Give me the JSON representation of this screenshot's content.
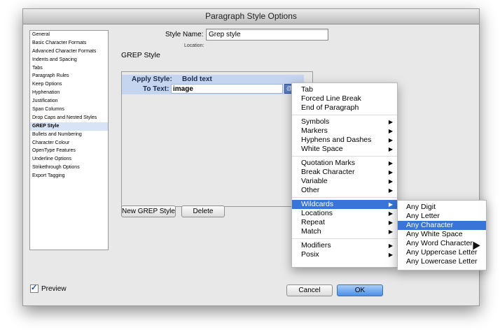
{
  "dialog": {
    "title": "Paragraph Style Options"
  },
  "categories": [
    "General",
    "Basic Character Formats",
    "Advanced Character Formats",
    "Indents and Spacing",
    "Tabs",
    "Paragraph Rules",
    "Keep Options",
    "Hyphenation",
    "Justification",
    "Span Columns",
    "Drop Caps and Nested Styles",
    "GREP Style",
    "Bullets and Numbering",
    "Character Colour",
    "OpenType Features",
    "Underline Options",
    "Strikethrough Options",
    "Export Tagging"
  ],
  "selected_category": "GREP Style",
  "style_name": {
    "label": "Style Name:",
    "value": "Grep style"
  },
  "location": {
    "label": "Location:"
  },
  "section_title": "GREP Style",
  "grep": {
    "apply_label": "Apply Style:",
    "apply_value": "Bold text",
    "to_label": "To Text:",
    "to_value": "image"
  },
  "buttons": {
    "new_grep": "New GREP Style",
    "delete": "Delete",
    "cancel": "Cancel",
    "ok": "OK"
  },
  "preview": {
    "label": "Preview",
    "checked": true
  },
  "menu": [
    {
      "label": "Tab"
    },
    {
      "label": "Forced Line Break"
    },
    {
      "label": "End of Paragraph"
    },
    {
      "sep": true
    },
    {
      "label": "Symbols",
      "sub": true
    },
    {
      "label": "Markers",
      "sub": true
    },
    {
      "label": "Hyphens and Dashes",
      "sub": true
    },
    {
      "label": "White Space",
      "sub": true
    },
    {
      "sep": true
    },
    {
      "label": "Quotation Marks",
      "sub": true
    },
    {
      "label": "Break Character",
      "sub": true
    },
    {
      "label": "Variable",
      "sub": true
    },
    {
      "label": "Other",
      "sub": true
    },
    {
      "sep": true
    },
    {
      "label": "Wildcards",
      "sub": true,
      "highlight": true
    },
    {
      "label": "Locations",
      "sub": true
    },
    {
      "label": "Repeat",
      "sub": true
    },
    {
      "label": "Match",
      "sub": true
    },
    {
      "sep": true
    },
    {
      "label": "Modifiers",
      "sub": true
    },
    {
      "label": "Posix",
      "sub": true
    }
  ],
  "submenu": [
    {
      "label": "Any Digit"
    },
    {
      "label": "Any Letter"
    },
    {
      "label": "Any Character",
      "highlight": true
    },
    {
      "label": "Any White Space"
    },
    {
      "label": "Any Word Character"
    },
    {
      "label": "Any Uppercase Letter"
    },
    {
      "label": "Any Lowercase Letter"
    }
  ]
}
